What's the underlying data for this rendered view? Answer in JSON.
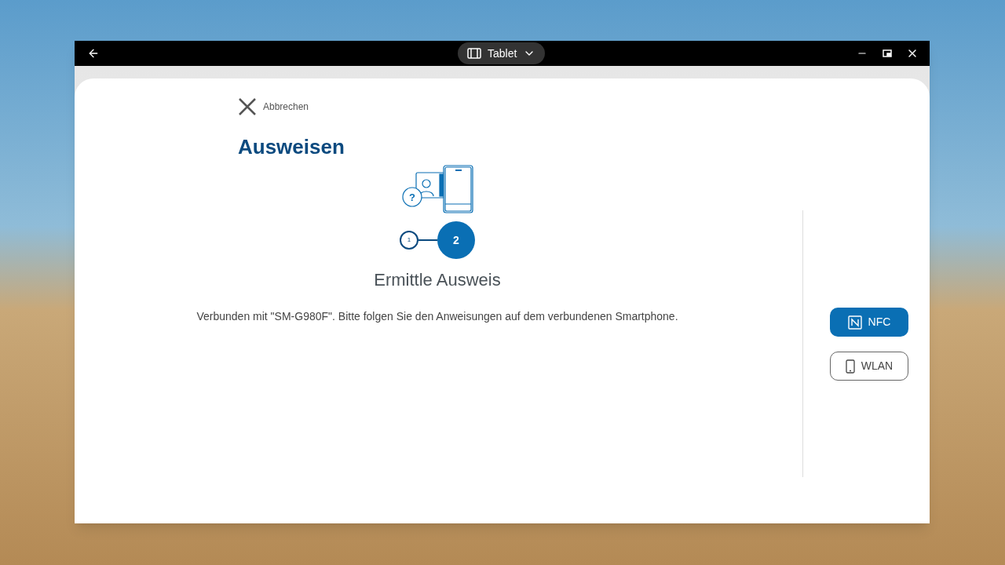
{
  "window": {
    "mode_label": "Tablet"
  },
  "cancel": {
    "label": "Abbrechen"
  },
  "title": "Ausweisen",
  "illustration_mark": "?",
  "steps": [
    {
      "label": "1",
      "selected": false
    },
    {
      "label": "2",
      "selected": true
    }
  ],
  "status_heading": "Ermittle Ausweis",
  "message": "Verbunden mit \"SM-G980F\". Bitte folgen Sie den Anweisungen auf dem verbundenen Smartphone.",
  "connection_modes": [
    {
      "kind": "nfc",
      "label": "NFC",
      "selected": true
    },
    {
      "kind": "wlan",
      "label": "WLAN",
      "selected": false
    }
  ]
}
